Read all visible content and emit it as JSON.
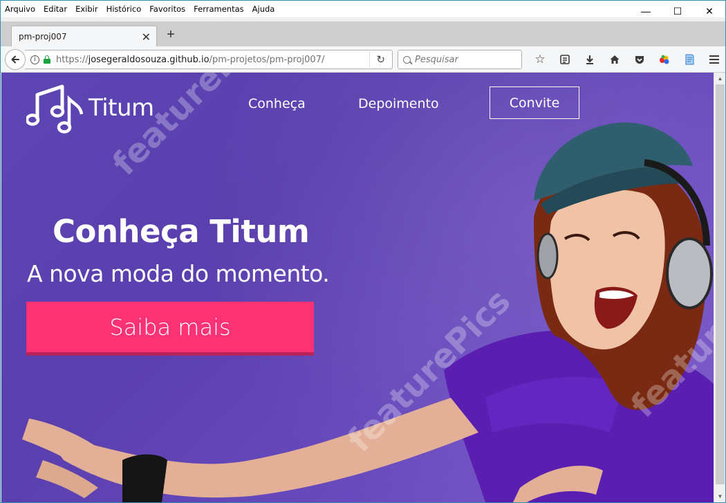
{
  "menubar": {
    "items": [
      "Arquivo",
      "Editar",
      "Exibir",
      "Histórico",
      "Favoritos",
      "Ferramentas",
      "Ajuda"
    ]
  },
  "window_controls": {
    "minimize": "—",
    "maximize": "☐",
    "close": "✕"
  },
  "tabs": [
    {
      "label": "pm-proj007",
      "close": "✕"
    }
  ],
  "newtab_label": "+",
  "navbar": {
    "url_scheme": "https://",
    "url_host": "josegeraldosouza.github.io",
    "url_path": "/pm-projetos/pm-proj007/",
    "search_placeholder": "Pesquisar"
  },
  "site": {
    "logo_text": "Titum",
    "nav": {
      "conheca": "Conheça",
      "depoimento": "Depoimento",
      "convite": "Convite"
    },
    "hero_title": "Conheça Titum",
    "hero_subtitle": "A nova moda do momento.",
    "cta_label": "Saiba mais",
    "watermark_text": "featurePics"
  },
  "colors": {
    "hero_bg": "#5d45b4",
    "cta_bg": "#fb3375",
    "cta_shadow": "#b8245a",
    "lock_green": "#1aa340"
  }
}
